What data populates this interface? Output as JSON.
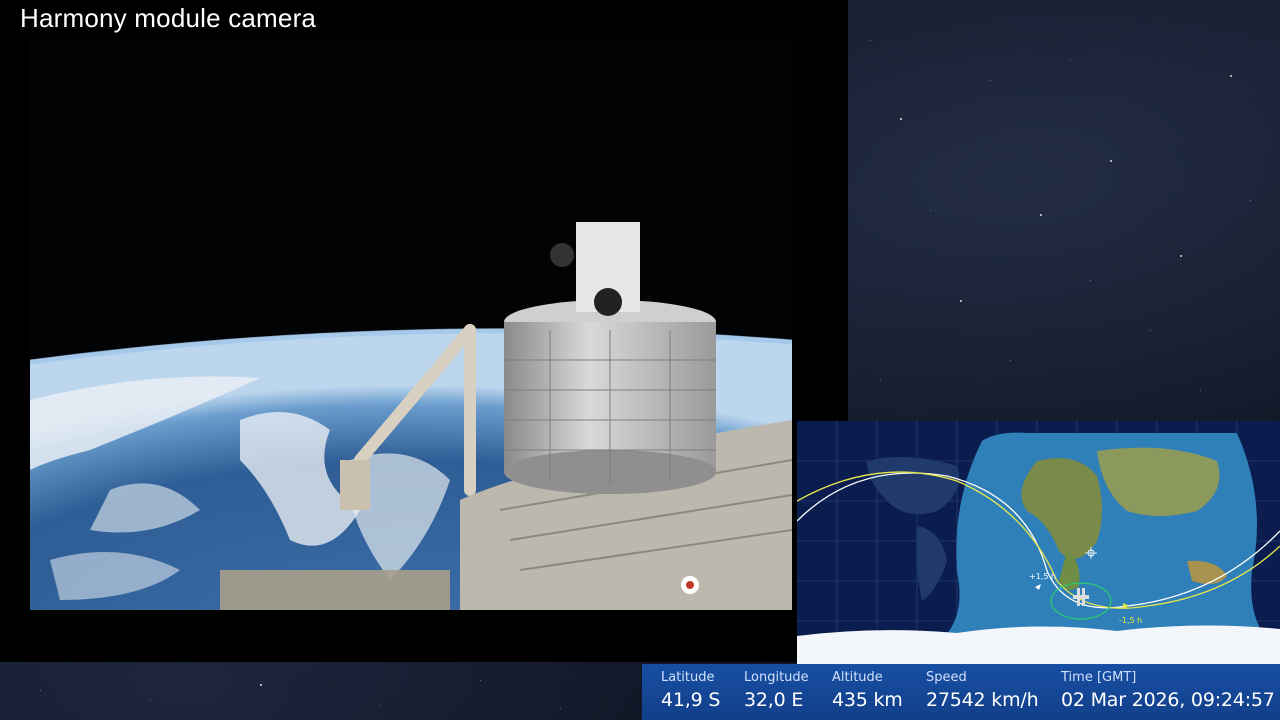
{
  "window": {
    "title": "Harmony module camera"
  },
  "camera_feed": {
    "content": "ISS external view",
    "flag_icon": "japan-flag-icon"
  },
  "tracker": {
    "markers": {
      "plus": "+1,5 h",
      "minus": "-1,5 h"
    },
    "satellite_icon": "iss-icon",
    "sun_icon": "sun-icon"
  },
  "telemetry": {
    "latitude": {
      "label": "Latitude",
      "value": "41,9 S"
    },
    "longitude": {
      "label": "Longitude",
      "value": "32,0 E"
    },
    "altitude": {
      "label": "Altitude",
      "value": "435 km"
    },
    "speed": {
      "label": "Speed",
      "value": "27542 km/h"
    },
    "time": {
      "label": "Time [GMT]",
      "value": "02 Mar 2026, 09:24:57"
    }
  },
  "colors": {
    "bar": "#174fa3",
    "orbit_future": "#e8e84a",
    "orbit_past": "#ffffff",
    "ground_station": "#2ecc71"
  }
}
